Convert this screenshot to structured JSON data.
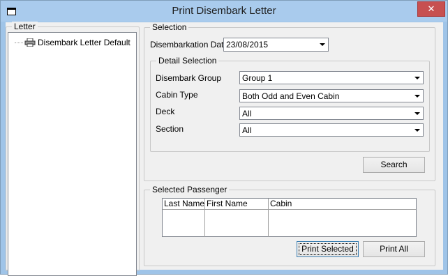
{
  "window": {
    "title": "Print Disembark Letter",
    "close_glyph": "✕"
  },
  "letter_group": {
    "legend": "Letter",
    "tree_items": [
      {
        "label": "Disembark Letter Default",
        "icon": "printer-icon"
      }
    ]
  },
  "selection": {
    "legend": "Selection",
    "date_label": "Disembarkation Date",
    "date_value": "23/08/2015",
    "detail": {
      "legend": "Detail Selection",
      "fields": [
        {
          "label": "Disembark Group",
          "value": "Group 1"
        },
        {
          "label": "Cabin Type",
          "value": "Both Odd and Even Cabin"
        },
        {
          "label": "Deck",
          "value": "All"
        },
        {
          "label": "Section",
          "value": "All"
        }
      ]
    },
    "search_label": "Search"
  },
  "passenger": {
    "legend": "Selected Passenger",
    "columns": [
      "Last Name",
      "First Name",
      "Cabin"
    ],
    "rows": [],
    "print_selected_label": "Print Selected",
    "print_all_label": "Print All"
  }
}
